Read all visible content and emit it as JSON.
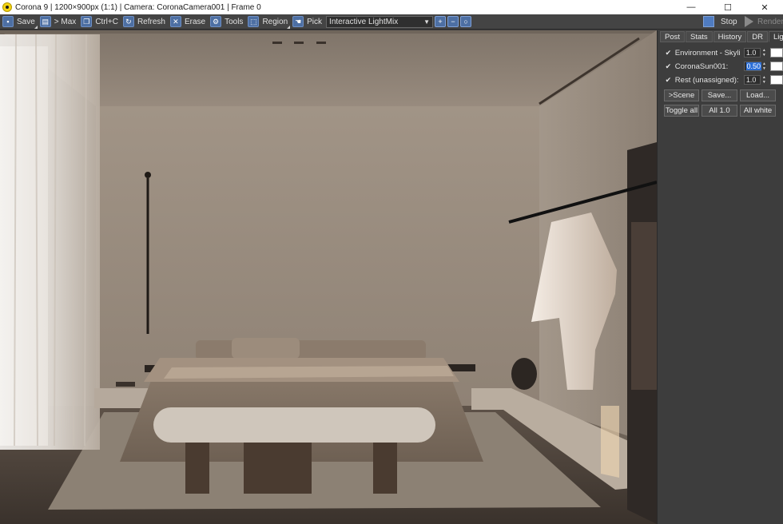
{
  "window": {
    "title": "Corona 9 | 1200×900px (1:1) | Camera: CoronaCamera001 | Frame 0",
    "minimize": "—",
    "maximize": "☐",
    "close": "✕"
  },
  "toolbar": {
    "save": "Save",
    "max": "> Max",
    "copy": "Ctrl+C",
    "refresh": "Refresh",
    "erase": "Erase",
    "tools": "Tools",
    "region": "Region",
    "pick": "Pick",
    "mode_value": "Interactive LightMix",
    "stop": "Stop",
    "render": "Render"
  },
  "panel": {
    "tabs": [
      "Post",
      "Stats",
      "History",
      "DR",
      "LightMix"
    ],
    "active_tab": "LightMix",
    "lights": [
      {
        "name": "Environment - Skylight",
        "value": "1.0",
        "enabled": true,
        "color": "#ffffff"
      },
      {
        "name": "CoronaSun001:",
        "value": "0.50",
        "enabled": true,
        "color": "#ffffff"
      },
      {
        "name": "Rest (unassigned):",
        "value": "1.0",
        "enabled": true,
        "color": "#ffffff"
      }
    ],
    "buttons_row1": [
      ">Scene",
      "Save...",
      "Load..."
    ],
    "buttons_row2": [
      "Toggle all",
      "All 1.0",
      "All white"
    ]
  }
}
